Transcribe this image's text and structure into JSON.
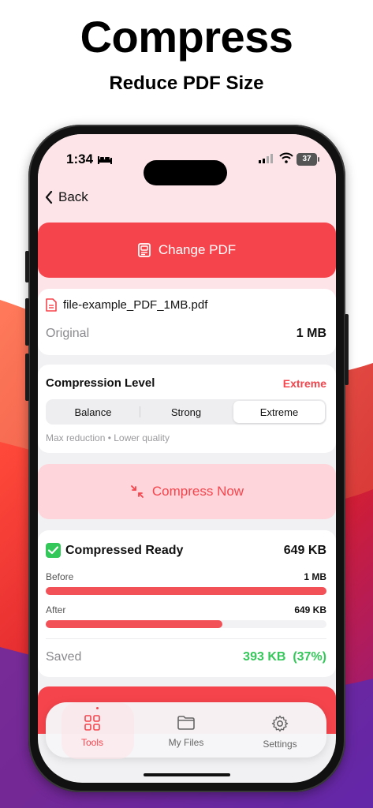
{
  "promo": {
    "title": "Compress",
    "subtitle": "Reduce PDF Size"
  },
  "status_bar": {
    "time": "1:34",
    "battery": "37"
  },
  "nav": {
    "back_label": "Back"
  },
  "change_pdf": {
    "label": "Change PDF",
    "icon": "pdf-doc-icon"
  },
  "file": {
    "name": "file-example_PDF_1MB.pdf",
    "original_label": "Original",
    "original_size": "1 MB"
  },
  "compression": {
    "title": "Compression Level",
    "selected": "Extreme",
    "options": [
      "Balance",
      "Strong",
      "Extreme"
    ],
    "hint": "Max reduction • Lower quality"
  },
  "compress_button": {
    "label": "Compress Now",
    "icon": "compress-arrows-icon"
  },
  "result": {
    "title": "Compressed Ready",
    "size": "649 KB",
    "before_label": "Before",
    "before_value": "1 MB",
    "before_fraction": 1.0,
    "after_label": "After",
    "after_value": "649 KB",
    "after_fraction": 0.63,
    "saved_label": "Saved",
    "saved_value": "393 KB  (37%)"
  },
  "tabs": [
    {
      "label": "Tools",
      "icon": "grid-icon",
      "active": true
    },
    {
      "label": "My Files",
      "icon": "folder-icon",
      "active": false
    },
    {
      "label": "Settings",
      "icon": "gear-icon",
      "active": false
    }
  ],
  "colors": {
    "accent": "#f6444c",
    "accent_light": "#fdd5da",
    "success": "#34c759",
    "header_pink": "#fde4e8"
  }
}
